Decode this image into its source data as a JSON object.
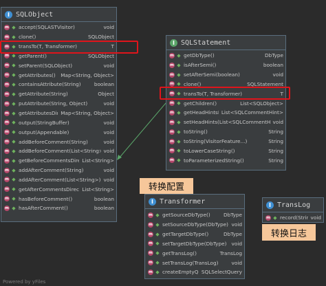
{
  "classes": {
    "sqlobject": {
      "title": "SQLObject",
      "icon": "I",
      "methods": [
        {
          "name": "accept(SQLASTVisitor)",
          "type": "void"
        },
        {
          "name": "clone()",
          "type": "SQLObject"
        },
        {
          "name": "transTo(T, Transformer)",
          "type": "T"
        },
        {
          "name": "getParent()",
          "type": "SQLObject"
        },
        {
          "name": "setParent(SQLObject)",
          "type": "void"
        },
        {
          "name": "getAttributes()",
          "type": "Map<String, Object>"
        },
        {
          "name": "containsAttribute(String)",
          "type": "boolean"
        },
        {
          "name": "getAttribute(String)",
          "type": "Object"
        },
        {
          "name": "putAttribute(String, Object)",
          "type": "void"
        },
        {
          "name": "getAttributesDirect()",
          "type": "Map<String, Object>"
        },
        {
          "name": "output(StringBuffer)",
          "type": "void"
        },
        {
          "name": "output(Appendable)",
          "type": "void"
        },
        {
          "name": "addBeforeComment(String)",
          "type": "void"
        },
        {
          "name": "addBeforeComment(List<String>)",
          "type": "void"
        },
        {
          "name": "getBeforeCommentsDirect()",
          "type": "List<String>"
        },
        {
          "name": "addAfterComment(String)",
          "type": "void"
        },
        {
          "name": "addAfterComment(List<String>)",
          "type": "void"
        },
        {
          "name": "getAfterCommentsDirect()",
          "type": "List<String>"
        },
        {
          "name": "hasBeforeComment()",
          "type": "boolean"
        },
        {
          "name": "hasAfterComment()",
          "type": "boolean"
        }
      ]
    },
    "sqlstatement": {
      "title": "SQLStatement",
      "icon": "I",
      "methods": [
        {
          "name": "getDbType()",
          "type": "DbType"
        },
        {
          "name": "isAfterSemi()",
          "type": "boolean"
        },
        {
          "name": "setAfterSemi(boolean)",
          "type": "void"
        },
        {
          "name": "clone()",
          "type": "SQLStatement"
        },
        {
          "name": "transTo(T, Transformer)",
          "type": "T"
        },
        {
          "name": "getChildren()",
          "type": "List<SQLObject>"
        },
        {
          "name": "getHeadHintsDirect()",
          "type": "List<SQLCommentHint>"
        },
        {
          "name": "setHeadHints(List<SQLCommentHint>)",
          "type": "void"
        },
        {
          "name": "toString()",
          "type": "String"
        },
        {
          "name": "toString(VisitorFeature...)",
          "type": "String"
        },
        {
          "name": "toLowerCaseString()",
          "type": "String"
        },
        {
          "name": "toParameterizedString()",
          "type": "String"
        }
      ]
    },
    "transformer": {
      "title": "Transformer",
      "icon": "I",
      "methods": [
        {
          "name": "getSourceDbType()",
          "type": "DbType"
        },
        {
          "name": "setSourceDbType(DbType)",
          "type": "void"
        },
        {
          "name": "getTargetDbType()",
          "type": "DbType"
        },
        {
          "name": "setTargetDbType(DbType)",
          "type": "void"
        },
        {
          "name": "getTransLog()",
          "type": "TransLog"
        },
        {
          "name": "setTransLog(TransLog)",
          "type": "void"
        },
        {
          "name": "createEmptyQuery()",
          "type": "SQLSelectQuery"
        }
      ]
    },
    "translog": {
      "title": "TransLog",
      "icon": "I",
      "methods": [
        {
          "name": "record(String)",
          "type": "void"
        }
      ]
    }
  },
  "captions": {
    "transformer_config": "转换配置",
    "translog": "转换日志"
  },
  "footer": "Powered by yFiles",
  "colors": {
    "highlight": "#e0141b",
    "caption_bg": "#f6c79a",
    "arrow": "#5aa469"
  }
}
